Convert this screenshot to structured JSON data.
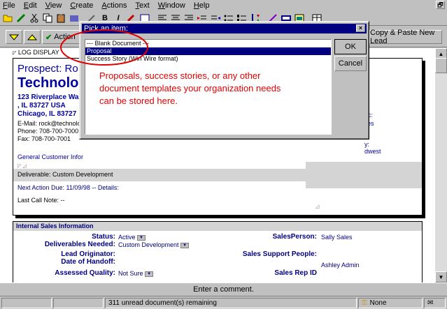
{
  "menu": [
    "File",
    "Edit",
    "View",
    "Create",
    "Actions",
    "Text",
    "Window",
    "Help"
  ],
  "menu_mnemonics": [
    "F",
    "E",
    "V",
    "C",
    "A",
    "T",
    "W",
    "H"
  ],
  "window_restore_glyph": "🗗",
  "toolbar": {
    "bold": "B",
    "italic": "I",
    "icons": [
      "open-icon",
      "edit-icon",
      "cut-icon",
      "copy-icon",
      "paste-icon",
      "attach-icon",
      "bold-icon",
      "italic-icon",
      "highlight-icon",
      "left-align-icon",
      "center-align-icon",
      "right-align-icon",
      "indent-icon",
      "bullet-icon",
      "number-icon",
      "sort-icon",
      "link-icon",
      "spell-icon",
      "table-icon"
    ]
  },
  "actionbar": {
    "action_label": "Action",
    "copy_paste_label": "Copy & Paste New Lead"
  },
  "document": {
    "log_display": "LOG DISPLAY",
    "prospect_label": "Prospect: Ro",
    "company_big": "Technolo",
    "address_line1": "123 Riverplace Wa",
    "address_line2": ", IL 83727 USA",
    "address_line3": "Chicago, IL 83727",
    "email": "E-Mail: rock@technolo",
    "phone": "Phone: 708-700-7000",
    "fax": "Fax: 708-700-7001",
    "gci_link": "General Customer Infor",
    "right_text1": "ec:",
    "right_text2": "lles",
    "right_text3": "y:",
    "right_text4": "dwest",
    "deliverable": "Deliverable: Custom Development",
    "next_action": "Next Action Due: 11/09/98 -- Details:",
    "last_call": "Last Call Note:  --"
  },
  "internal_sales": {
    "header": "Internal Sales Information",
    "status_label": "Status:",
    "status_value": "Active",
    "deliverables_label": "Deliverables Needed:",
    "deliverables_value": "Custom Development",
    "lead_orig_label": "Lead Originator:",
    "date_handoff_label": "Date of Handoff:",
    "assessed_label": "Assessed Quality:",
    "assessed_value": "Not Sure",
    "salesperson_label": "SalesPerson:",
    "salesperson_value": "Sally Sales",
    "support_label": "Sales Support People:",
    "support_value": "Ashley Admin",
    "rep_id_label": "Sales Rep ID"
  },
  "comment_bar": "Enter a comment.",
  "status": {
    "unread": "311 unread document(s) remaining",
    "location": "None"
  },
  "dialog": {
    "title": "Pick an item:",
    "items": [
      "--- Blank Document ---",
      "Proposal",
      "Success Story (Win Wire format)"
    ],
    "selected_index": 1,
    "ok_label": "OK",
    "cancel_label": "Cancel",
    "close_glyph": "×",
    "annotation_line1": "Proposals, success stories, or any other",
    "annotation_line2": "document templates your organization needs",
    "annotation_line3": "can be stored here."
  },
  "colors": {
    "titlebar": "#000080",
    "selection": "#000080",
    "annotation": "#e00000",
    "link_blue": "#0000a0"
  }
}
